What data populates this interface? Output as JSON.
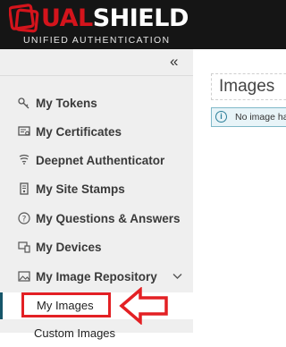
{
  "brand": {
    "name_left": "D",
    "name_mid": "UAL",
    "name_right": "SHIELD",
    "subtitle": "UNIFIED AUTHENTICATION"
  },
  "sidebar": {
    "collapse_glyph": "«",
    "items": [
      {
        "label": "My Tokens",
        "icon": "key-icon"
      },
      {
        "label": "My Certificates",
        "icon": "certificate-icon"
      },
      {
        "label": "Deepnet Authenticator",
        "icon": "authenticator-icon"
      },
      {
        "label": "My Site Stamps",
        "icon": "site-stamp-icon"
      },
      {
        "label": "My Questions & Answers",
        "icon": "question-icon"
      },
      {
        "label": "My Devices",
        "icon": "devices-icon"
      },
      {
        "label": "My Image Repository",
        "icon": "image-icon",
        "expanded": true
      }
    ],
    "subitems": [
      {
        "label": "My Images",
        "active": true
      },
      {
        "label": "Custom Images"
      }
    ]
  },
  "main": {
    "title": "Images",
    "info_text": "No image ha"
  },
  "colors": {
    "brand_red": "#d4141c",
    "active_border": "#16566a",
    "highlight_red": "#e32024",
    "info_bg": "#e8f4f8"
  }
}
